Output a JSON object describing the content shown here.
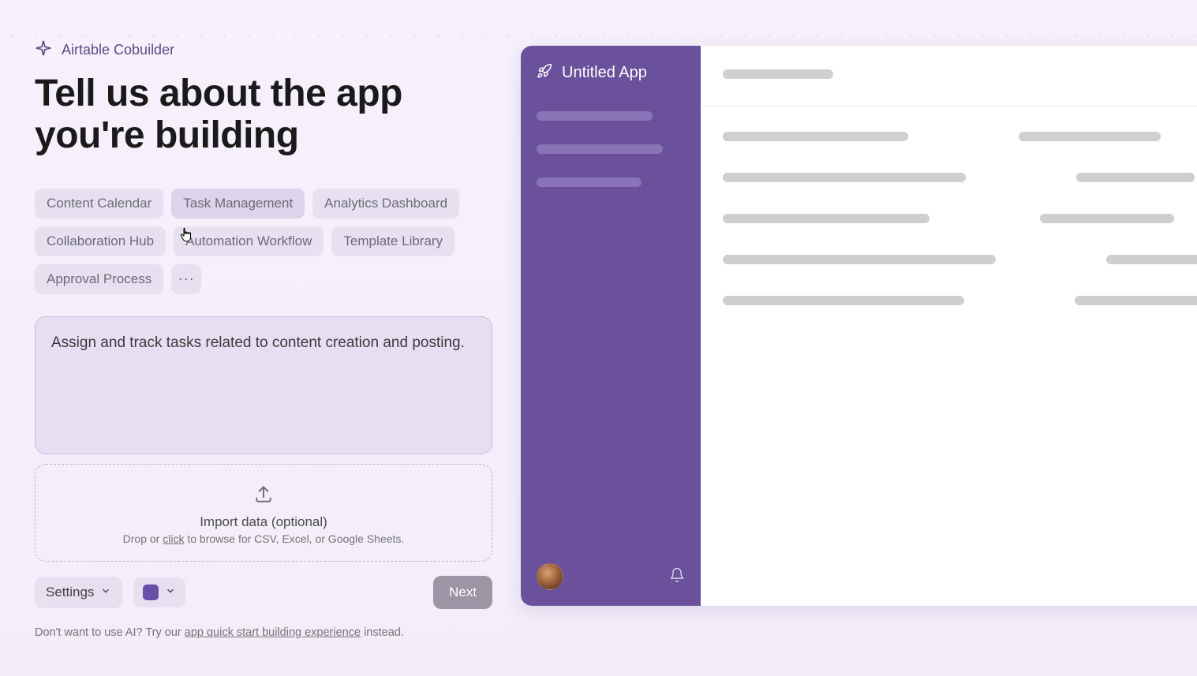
{
  "brand": "Airtable Cobuilder",
  "headline": "Tell us about the app you're building",
  "chips": [
    "Content Calendar",
    "Task Management",
    "Analytics Dashboard",
    "Collaboration Hub",
    "Automation Workflow",
    "Template Library",
    "Approval Process"
  ],
  "hovered_chip_index": 1,
  "description": "Assign and track tasks related to content creation and posting.",
  "import": {
    "title": "Import data (optional)",
    "prefix": "Drop or ",
    "link": "click",
    "suffix": " to browse for CSV, Excel, or Google Sheets."
  },
  "settings_label": "Settings",
  "next_label": "Next",
  "accent_color": "#6a4ea8",
  "alt": {
    "prefix": "Don't want to use AI? Try our ",
    "link": "app quick start building experience",
    "suffix": " instead."
  },
  "preview": {
    "title": "Untitled App"
  }
}
